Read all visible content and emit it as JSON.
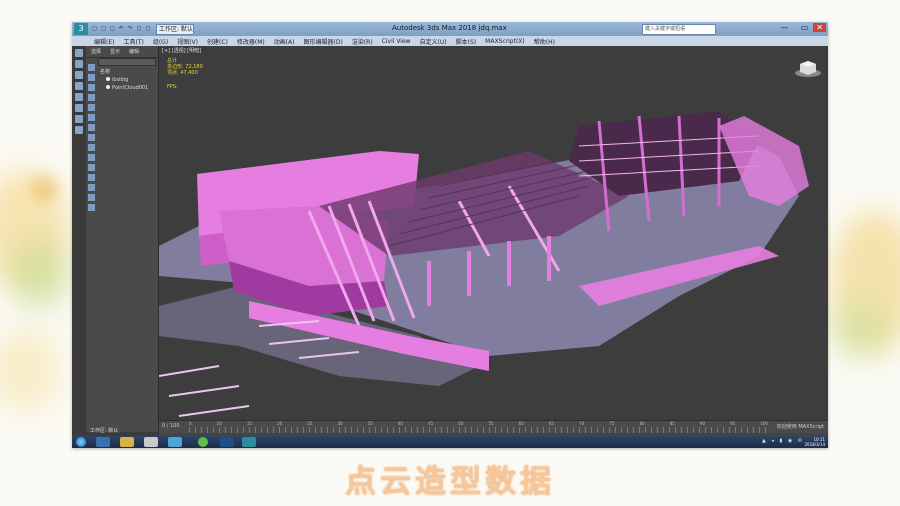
{
  "window": {
    "title": "Autodesk 3ds Max 2018   jdq.max",
    "workspace_tab": "工作区: 默认",
    "quick_access": "◻ ◻ ◻ ↶ ↷ ◻ ◻",
    "search_placeholder": "键入关键字或短语",
    "controls": "— ▭"
  },
  "menu": {
    "items": [
      "编辑(E)",
      "工具(T)",
      "组(G)",
      "视图(V)",
      "创建(C)",
      "修改器(M)",
      "动画(A)",
      "图形编辑器(D)",
      "渲染(R)",
      "Civil View",
      "自定义(U)",
      "脚本(S)",
      "MAXScript(X)",
      "帮助(H)"
    ]
  },
  "explorer": {
    "tabs": [
      "选择",
      "显示",
      "编辑"
    ],
    "root": "名称",
    "items": [
      "ibslbig",
      "PointCloud001"
    ]
  },
  "viewport": {
    "label": "[+] [透视] [明暗]",
    "stats_title": "总计",
    "poly_label": "多边形:",
    "poly_value": "72,180",
    "vert_label": "顶点:",
    "vert_value": "47,400",
    "fps": "FPS:"
  },
  "timeline": {
    "frame": "0 / 100",
    "tick_labels": [
      "0",
      "10",
      "15",
      "20",
      "25",
      "30",
      "35",
      "40",
      "45",
      "50",
      "55",
      "60",
      "65",
      "70",
      "75",
      "80",
      "85",
      "90",
      "95",
      "100"
    ],
    "status_right": "欢迎使用 MAXScript"
  },
  "statusbar": {
    "workspace": "工作区: 默认"
  },
  "taskbar": {
    "clock_time": "10:11",
    "clock_date": "2018/3/14"
  },
  "caption": "点云造型数据",
  "colors": {
    "model_pink": "#e57ee0",
    "model_purple": "#a86bd4",
    "model_lavender": "#b9b2f0",
    "model_dark": "#4a2a4a",
    "caption": "#f6c79a"
  }
}
